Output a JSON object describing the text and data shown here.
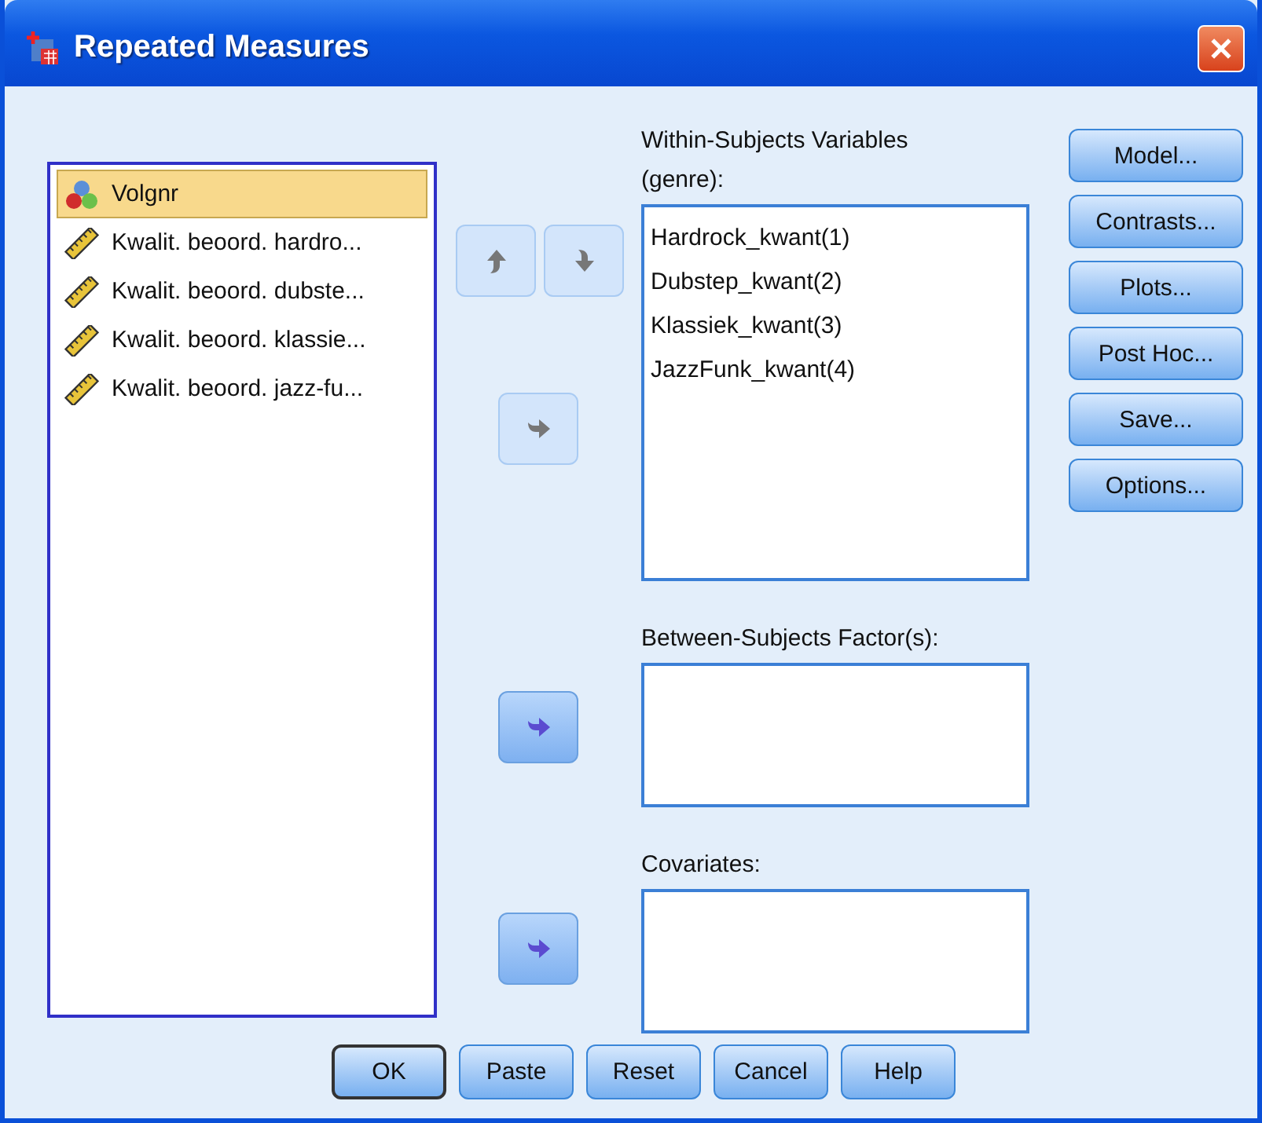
{
  "window": {
    "title": "Repeated Measures"
  },
  "source_variables": [
    {
      "name": "Volgnr",
      "kind": "nominal",
      "selected": true
    },
    {
      "name": "Kwalit. beoord. hardro...",
      "kind": "scale",
      "selected": false
    },
    {
      "name": "Kwalit. beoord. dubste...",
      "kind": "scale",
      "selected": false
    },
    {
      "name": "Kwalit. beoord. klassie...",
      "kind": "scale",
      "selected": false
    },
    {
      "name": "Kwalit. beoord. jazz-fu...",
      "kind": "scale",
      "selected": false
    }
  ],
  "order_buttons": [
    {
      "kind": "up",
      "disabled": true
    },
    {
      "kind": "down",
      "disabled": true
    }
  ],
  "within_subjects": {
    "label": "Within-Subjects Variables (genre):",
    "move_button": {
      "disabled": true
    },
    "items": [
      "Hardrock_kwant(1)",
      "Dubstep_kwant(2)",
      "Klassiek_kwant(3)",
      "JazzFunk_kwant(4)"
    ]
  },
  "between_subjects": {
    "label": "Between-Subjects Factor(s):",
    "move_button": {
      "disabled": false
    }
  },
  "covariates": {
    "label": "Covariates:",
    "move_button": {
      "disabled": false
    }
  },
  "side_buttons": [
    "Model...",
    "Contrasts...",
    "Plots...",
    "Post Hoc...",
    "Save...",
    "Options..."
  ],
  "bottom_buttons": [
    {
      "label": "OK",
      "default": true
    },
    {
      "label": "Paste",
      "default": false
    },
    {
      "label": "Reset",
      "default": false
    },
    {
      "label": "Cancel",
      "default": false
    },
    {
      "label": "Help",
      "default": false
    }
  ]
}
